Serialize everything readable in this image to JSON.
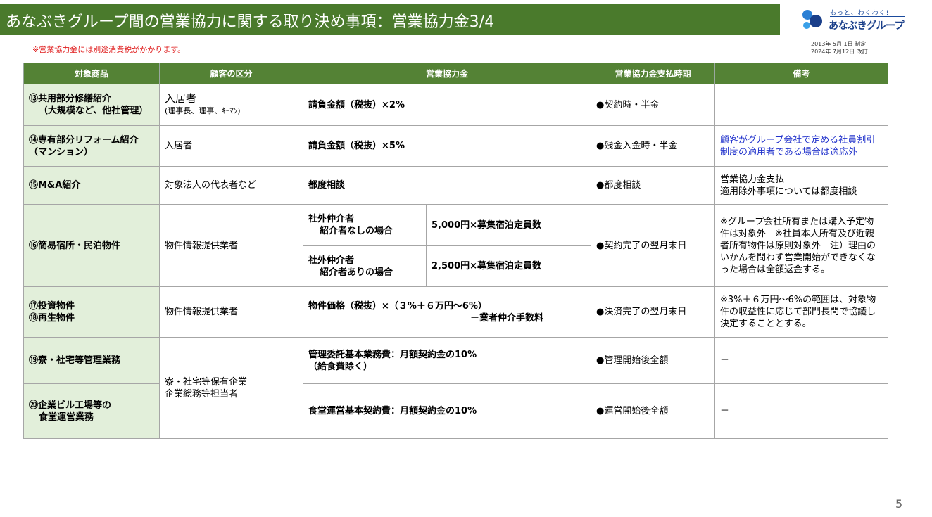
{
  "header": {
    "title": "あなぶきグループ間の営業協力に関する取り決め事項：営業協力金3/4",
    "tax_note": "※営業協力金には別途消費税がかかります。"
  },
  "logo": {
    "tagline": "もっと、わくわく!",
    "name": "あなぶきグループ"
  },
  "dates": {
    "established": "2013年  5月 1日 制定",
    "revised": "2024年 7月12日 改訂"
  },
  "table": {
    "headers": [
      "対象商品",
      "顧客の区分",
      "営業協力金",
      "営業協力金支払時期",
      "備考"
    ],
    "rows": {
      "r13": {
        "product_1": "⑬共用部分修繕紹介",
        "product_2": "（大規模など、他社管理）",
        "customer_1": "入居者",
        "customer_2": "(理事長、理事、ｷｰﾏﾝ)",
        "fee": "請負金額（税抜）×2%",
        "timing": "●契約時・半金",
        "note": ""
      },
      "r14": {
        "product_1": "⑭専有部分リフォーム紹介",
        "product_2": "（マンション）",
        "customer": "入居者",
        "fee": "請負金額（税抜）×5%",
        "timing": "●残金入金時・半金",
        "note_1": "顧客がグループ会社で定める社員割引",
        "note_2": "制度の適用者である場合は適応外"
      },
      "r15": {
        "product": "⑮M&A紹介",
        "customer": "対象法人の代表者など",
        "fee": "都度相談",
        "timing": "●都度相談",
        "note_1": "営業協力金支払",
        "note_2": "適用除外事項については都度相談"
      },
      "r16": {
        "product": "⑯簡易宿所・民泊物件",
        "customer": "物件情報提供業者",
        "case_a_1": "社外仲介者",
        "case_a_2": "紹介者なしの場合",
        "fee_a": "5,000円×募集宿泊定員数",
        "case_b_1": "社外仲介者",
        "case_b_2": "紹介者ありの場合",
        "fee_b": "2,500円×募集宿泊定員数",
        "timing": "●契約完了の翌月末日",
        "note": "※グループ会社所有または購入予定物件は対象外　※社員本人所有及び近親者所有物件は原則対象外　注）理由のいかんを問わず営業開始ができなくなった場合は全額返金する。"
      },
      "r17": {
        "product_1": "⑰投資物件",
        "product_2": "⑱再生物件",
        "customer": "物件情報提供業者",
        "fee_1": "物件価格（税抜）×（３%＋６万円〜6%）",
        "fee_2": "－業者仲介手数料",
        "timing": "●決済完了の翌月末日",
        "note": "※3%＋６万円〜6%の範囲は、対象物件の収益性に応じて部門長間で協議し決定することとする。"
      },
      "r19": {
        "product": "⑲寮・社宅等管理業務",
        "customer_1": "寮・社宅等保有企業",
        "customer_2": "企業総務等担当者",
        "fee_1": "管理委託基本業務費：月額契約金の10%",
        "fee_2": "（給食費除く）",
        "timing": "●管理開始後全額",
        "note": "－"
      },
      "r20": {
        "product_1": "⑳企業ビル工場等の",
        "product_2": "食堂運営業務",
        "fee": "食堂運営基本契約費：月額契約金の10%",
        "timing": "●運営開始後全額",
        "note": "－"
      }
    }
  },
  "footer": {
    "page_number": "5"
  },
  "colors": {
    "title_bg": "#4a7a2c",
    "header_bg": "#548235",
    "product_bg": "#e2efda",
    "note_red": "#e02020",
    "note_blue": "#2233cc",
    "logo_blue": "#1a3f8a"
  },
  "icons": {
    "logo_mark": "anabuki-logo-icon"
  }
}
